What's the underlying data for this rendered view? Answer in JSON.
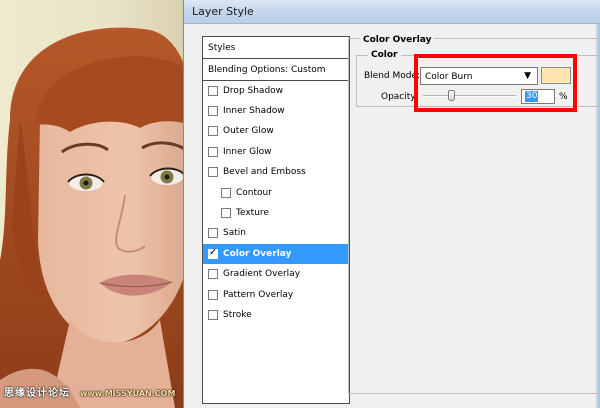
{
  "window": {
    "title": "Layer Style"
  },
  "styles_list": {
    "header": "Styles",
    "blending": "Blending Options: Custom",
    "items": [
      {
        "label": "Drop Shadow",
        "checked": false,
        "sub": false,
        "selected": false
      },
      {
        "label": "Inner Shadow",
        "checked": false,
        "sub": false,
        "selected": false
      },
      {
        "label": "Outer Glow",
        "checked": false,
        "sub": false,
        "selected": false
      },
      {
        "label": "Inner Glow",
        "checked": false,
        "sub": false,
        "selected": false
      },
      {
        "label": "Bevel and Emboss",
        "checked": false,
        "sub": false,
        "selected": false
      },
      {
        "label": "Contour",
        "checked": false,
        "sub": true,
        "selected": false
      },
      {
        "label": "Texture",
        "checked": false,
        "sub": true,
        "selected": false
      },
      {
        "label": "Satin",
        "checked": false,
        "sub": false,
        "selected": false
      },
      {
        "label": "Color Overlay",
        "checked": true,
        "sub": false,
        "selected": true
      },
      {
        "label": "Gradient Overlay",
        "checked": false,
        "sub": false,
        "selected": false
      },
      {
        "label": "Pattern Overlay",
        "checked": false,
        "sub": false,
        "selected": false
      },
      {
        "label": "Stroke",
        "checked": false,
        "sub": false,
        "selected": false
      }
    ]
  },
  "color_overlay": {
    "group_title": "Color Overlay",
    "sub_title": "Color",
    "blend_mode_label": "Blend Mode:",
    "blend_mode_value": "Color Burn",
    "dropdown_arrow": "▼",
    "swatch_color": "#ffe6b0",
    "opacity_label": "Opacity:",
    "opacity_value": "30",
    "opacity_fraction": 0.3,
    "percent": "%"
  },
  "checkmark": "✓",
  "watermark": {
    "text": "思缘设计论坛",
    "site": "www.MISSYUAN.COM"
  },
  "colors": {
    "selected_bg": "#3399ff",
    "highlight": "#ff0000"
  }
}
